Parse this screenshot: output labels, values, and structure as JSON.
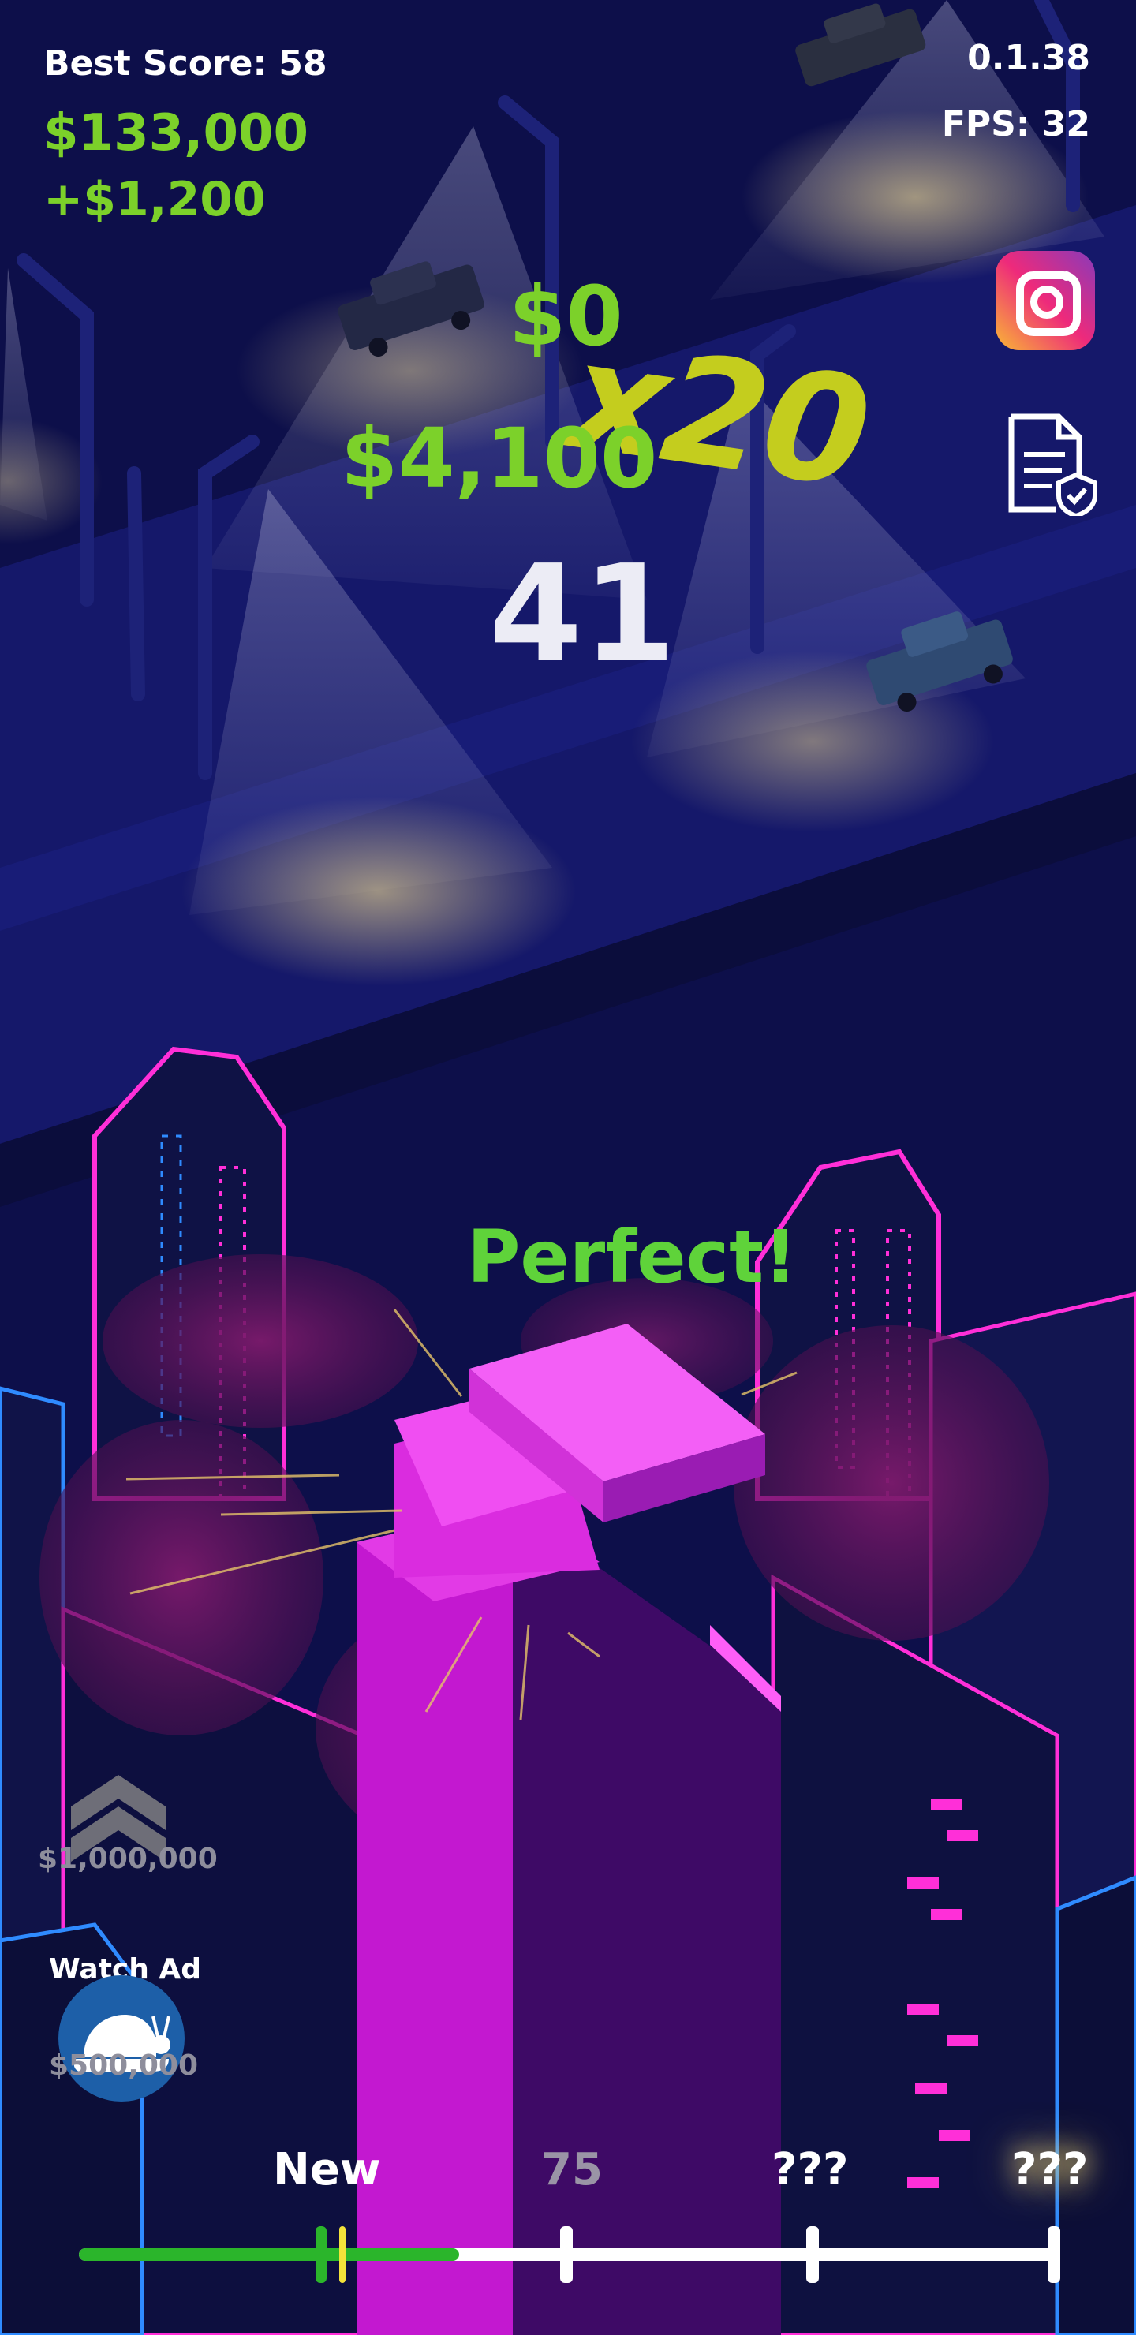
{
  "hud": {
    "best_score": "Best Score: 58",
    "money": "$133,000",
    "money_delta": "+$1,200",
    "version": "0.1.38",
    "fps": "FPS: 32"
  },
  "round": {
    "round_money": "$0",
    "multiplier": "x20",
    "earned": "$4,100",
    "score": "41",
    "feedback": "Perfect!"
  },
  "buttons": {
    "instagram_icon": "instagram-icon",
    "privacy_icon": "privacy-document-icon",
    "upgrade_price": "$1,000,000",
    "watch_ad_label": "Watch Ad",
    "slow_motion_icon": "snail-icon",
    "slow_motion_price": "$500,000"
  },
  "progress": {
    "labels": [
      "New",
      "75",
      "???",
      "???"
    ],
    "fill_fraction": 0.39
  },
  "colors": {
    "money_green": "#7cd12a",
    "multiplier_yellow": "#c4cd1e",
    "perfect_green": "#5fd33a",
    "tower_magenta": "#d11ed9",
    "night_blue": "#0d0f4a",
    "neon_pink": "#ff2fd8",
    "neon_blue": "#2f8bff"
  }
}
